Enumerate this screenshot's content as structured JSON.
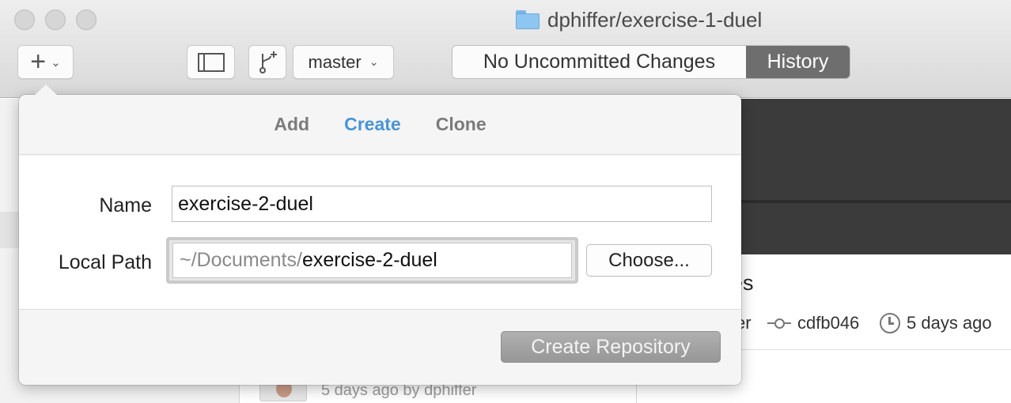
{
  "window": {
    "title": "dphiffer/exercise-1-duel"
  },
  "toolbar": {
    "branch_selector": "master",
    "segment_changes": "No Uncommitted Changes",
    "segment_history": "History"
  },
  "popover": {
    "tabs": [
      {
        "label": "Add",
        "active": false
      },
      {
        "label": "Create",
        "active": true
      },
      {
        "label": "Clone",
        "active": false
      }
    ],
    "name_label": "Name",
    "name_value": "exercise-2-duel",
    "local_path_label": "Local Path",
    "local_path_prefix": "~/Documents/",
    "local_path_value": "exercise-2-duel",
    "choose_button": "Choose...",
    "create_button": "Create Repository"
  },
  "background": {
    "commit_title_fragment": "es",
    "commit_author_fragment": "er",
    "commit_sha": "cdfb046",
    "commit_time": "5 days ago",
    "history_item_meta": "5 days ago by dphiffer"
  },
  "colors": {
    "active_tab": "#4a94d4",
    "history_segment_bg": "#6e6e6e",
    "dark_panel": "#3b3b3b"
  },
  "icons": [
    "folder-icon",
    "plus-icon",
    "chevron-down-icon",
    "sidebar-toggle-icon",
    "branch-icon",
    "commit-sha-icon",
    "clock-icon"
  ]
}
